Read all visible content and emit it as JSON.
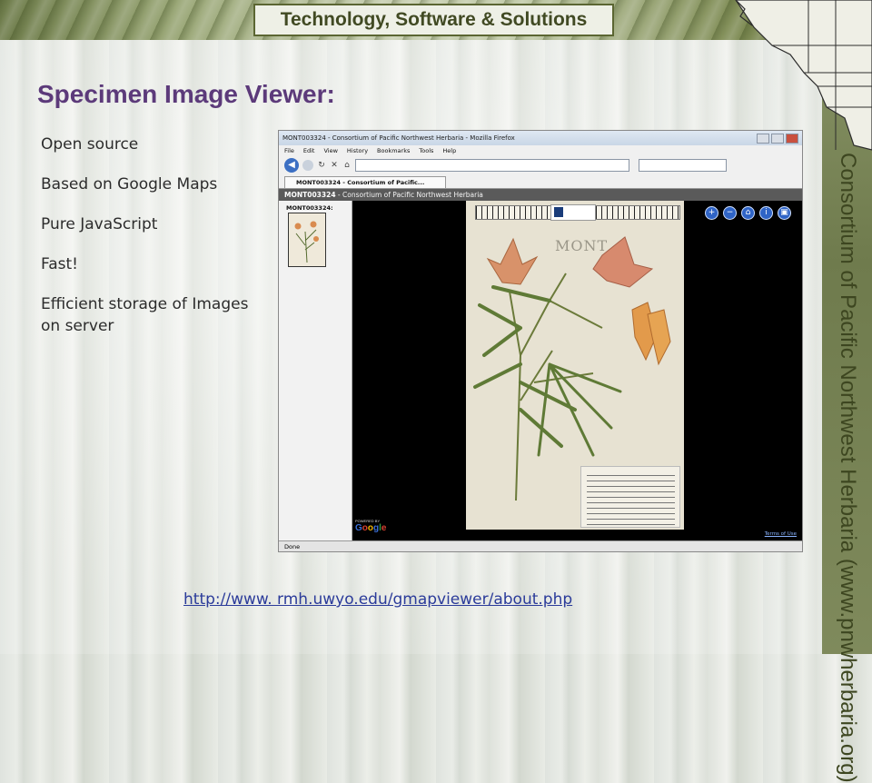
{
  "slide": {
    "banner_title": "Technology, Software & Solutions",
    "heading": "Specimen Image Viewer:",
    "bullets": [
      "Open source",
      "Based on Google Maps",
      "Pure JavaScript",
      "Fast!",
      "Efficient storage of Images on server"
    ],
    "url": "http://www. rmh.uwyo.edu/gmapviewer/about.php",
    "vertical_brand": "Consortium of Pacific Northwest Herbaria (www.pnwherbaria.org)"
  },
  "browser": {
    "window_title": "MONT003324 - Consortium of Pacific Northwest Herbaria - Mozilla Firefox",
    "menu": [
      "File",
      "Edit",
      "View",
      "History",
      "Bookmarks",
      "Tools",
      "Help"
    ],
    "tab_label": "MONT003324 - Consortium of Pacific...",
    "viewer_header_id": "MONT003324",
    "viewer_header_rest": " - Consortium of Pacific Northwest Herbaria",
    "thumb_label": "MONT003324:",
    "sheet_stamp": "MONT",
    "powered_by": "POWERED BY",
    "terms": "Terms of Use",
    "status": "Done"
  },
  "colors": {
    "heading": "#5c3a7a",
    "url": "#2b3b9a",
    "banner": "#6f7d4c"
  }
}
